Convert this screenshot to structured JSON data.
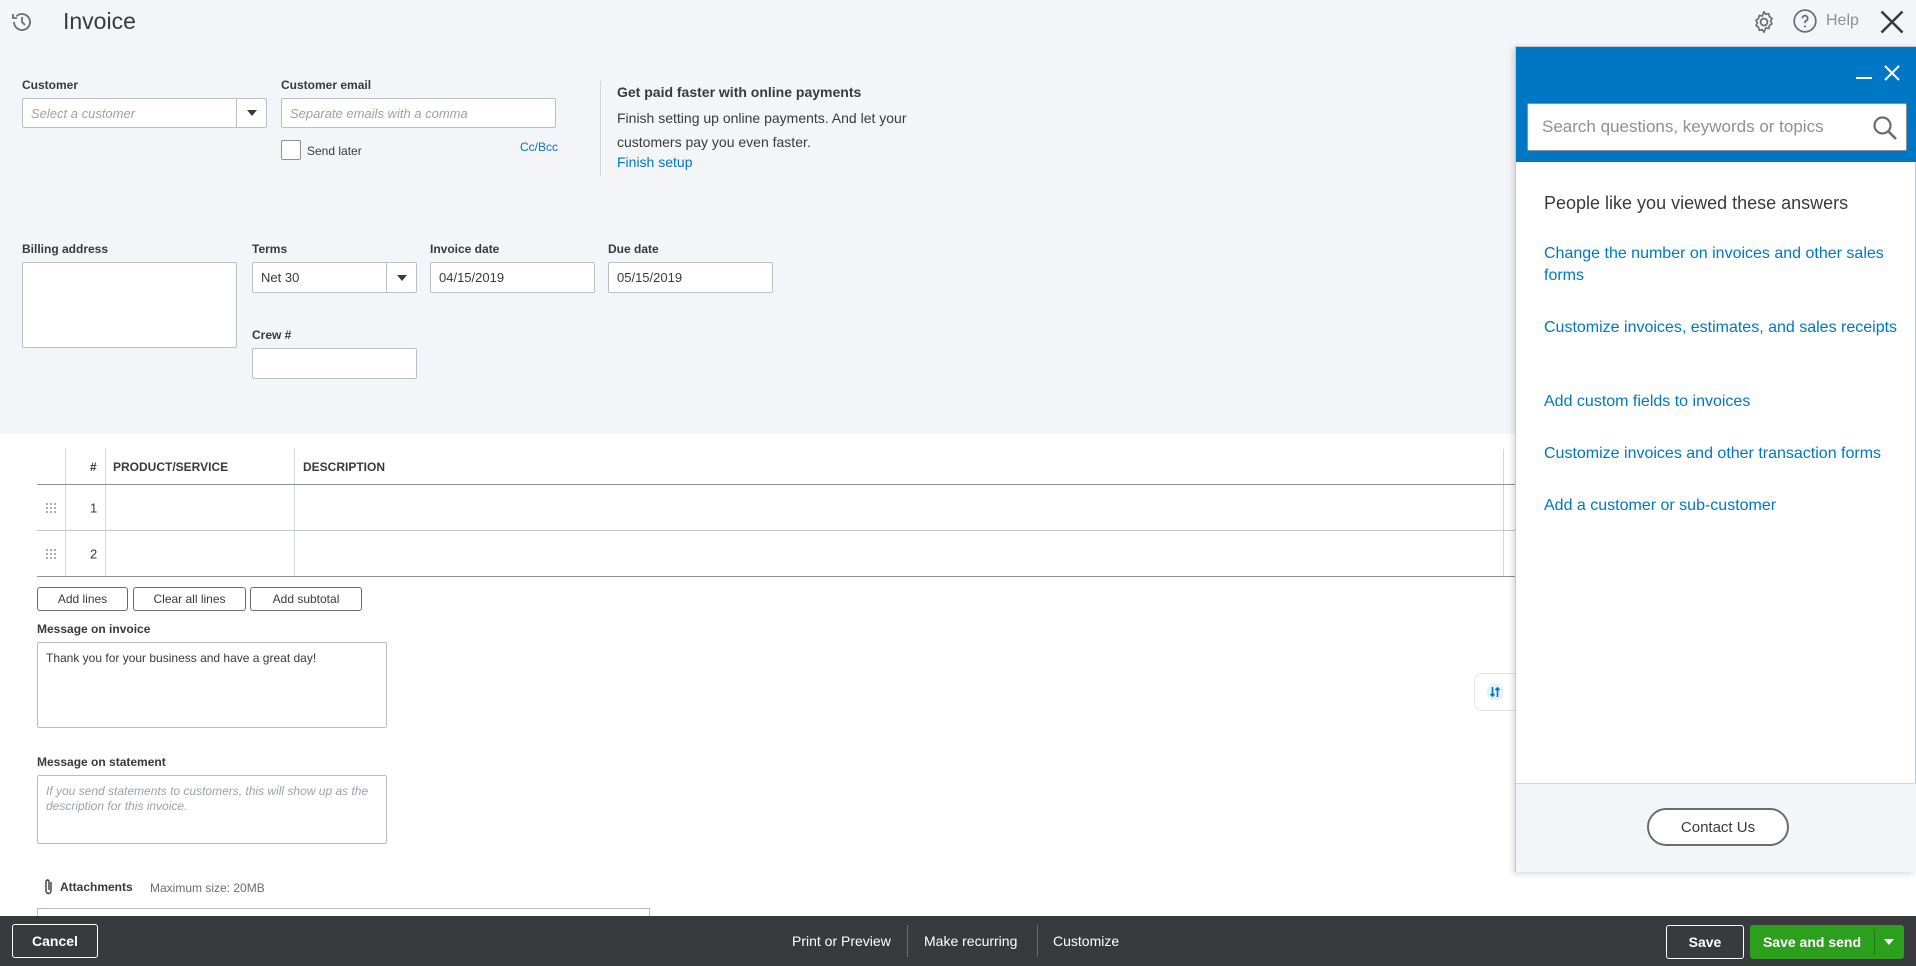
{
  "header": {
    "title": "Invoice",
    "help_label": "Help",
    "icons": [
      "history-icon",
      "gear-icon",
      "help-icon",
      "close-icon"
    ]
  },
  "form": {
    "customer": {
      "label": "Customer",
      "placeholder": "Select a customer"
    },
    "customer_email": {
      "label": "Customer email",
      "placeholder": "Separate emails with a comma"
    },
    "send_later_label": "Send later",
    "cc_bcc_label": "Cc/Bcc",
    "promo": {
      "title": "Get paid faster with online payments",
      "body": "Finish setting up online payments. And let your customers pay you even faster.",
      "link": "Finish setup"
    },
    "billing_address": {
      "label": "Billing address",
      "value": ""
    },
    "terms": {
      "label": "Terms",
      "value": "Net 30"
    },
    "invoice_date": {
      "label": "Invoice date",
      "value": "04/15/2019"
    },
    "due_date": {
      "label": "Due date",
      "value": "05/15/2019"
    },
    "crew": {
      "label": "Crew #",
      "value": ""
    }
  },
  "line_items": {
    "columns": [
      "#",
      "PRODUCT/SERVICE",
      "DESCRIPTION"
    ],
    "rows": [
      {
        "num": "1",
        "product": "",
        "description": ""
      },
      {
        "num": "2",
        "product": "",
        "description": ""
      }
    ],
    "buttons": {
      "add_lines": "Add lines",
      "clear_all": "Clear all lines",
      "add_subtotal": "Add subtotal"
    }
  },
  "messages": {
    "invoice_label": "Message on invoice",
    "invoice_value": "Thank you for your business and have a great day!",
    "statement_label": "Message on statement",
    "statement_placeholder": "If you send statements to customers, this will show up as the description for this invoice."
  },
  "attachments": {
    "label": "Attachments",
    "note": "Maximum size: 20MB"
  },
  "footer": {
    "cancel": "Cancel",
    "print_preview": "Print or Preview",
    "make_recurring": "Make recurring",
    "customize": "Customize",
    "save": "Save",
    "save_and_send": "Save and send"
  },
  "help_panel": {
    "search_placeholder": "Search questions, keywords or topics",
    "subtitle": "People like you viewed these answers",
    "links": [
      "Change the number on invoices and other sales forms",
      "Customize invoices, estimates, and sales receipts",
      "Add custom fields to invoices",
      "Customize invoices and other transaction forms",
      "Add a customer or sub-customer"
    ],
    "contact": "Contact Us"
  },
  "colors": {
    "accent": "#0077c5",
    "primary_button": "#2ca01c",
    "footer_bg": "#393a3d",
    "page_bg": "#f4f5f8"
  }
}
